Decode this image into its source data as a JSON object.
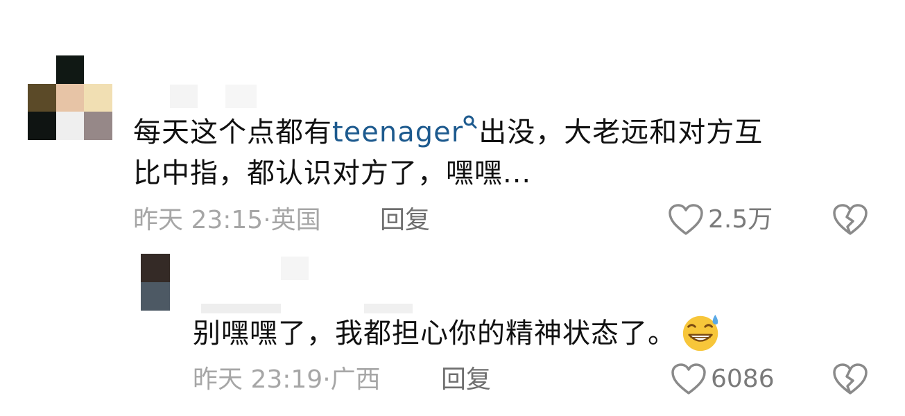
{
  "comments": [
    {
      "text_before": "每天这个点都有",
      "keyword": "teenager",
      "text_after": "出没，大老远和对方互",
      "text_line2": "比中指，都认识对方了，嘿嘿...",
      "time": "昨天 23:15",
      "location": "英国",
      "reply_label": "回复",
      "likes": "2.5万"
    },
    {
      "text": "别嘿嘿了，我都担心你的精神状态了。",
      "emoji": "grinning-sweat-emoji",
      "time": "昨天 23:19",
      "location": "广西",
      "reply_label": "回复",
      "likes": "6086"
    }
  ],
  "meta_separator": "·",
  "colors": {
    "text": "#111111",
    "meta": "#a6a6a6",
    "keyword": "#1d5a8e",
    "icon": "#8a8a8a"
  },
  "avatar_main_pixels": [
    "#ffffff",
    "#101814",
    "#ffffff",
    "#5b4a28",
    "#e7c4a6",
    "#f1dfb3",
    "#0f1412",
    "#efefef",
    "#968888"
  ],
  "avatar_reply_pixels": [
    "#342a26",
    "#4d5964"
  ]
}
